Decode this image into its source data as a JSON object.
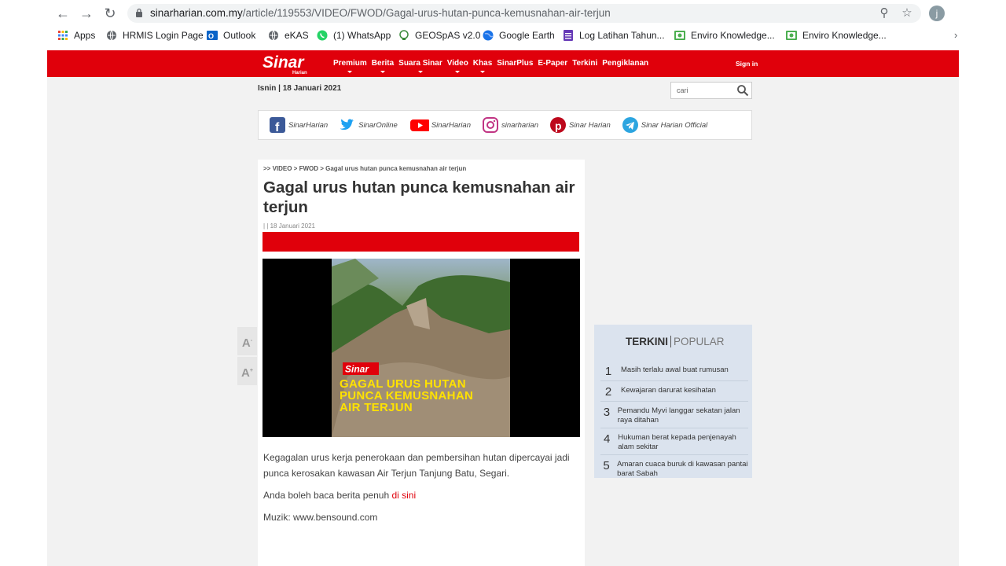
{
  "browser": {
    "url_host": "sinarharian.com.my",
    "url_path": "/article/119553/VIDEO/FWOD/Gagal-urus-hutan-punca-kemusnahan-air-terjun",
    "profile_initial": "j",
    "bookmarks": [
      {
        "label": "Apps",
        "icon": "apps-grid-icon"
      },
      {
        "label": "HRMIS Login Page",
        "icon": "globe-icon"
      },
      {
        "label": "Outlook",
        "icon": "outlook-icon"
      },
      {
        "label": "eKAS",
        "icon": "globe-icon"
      },
      {
        "label": "(1) WhatsApp",
        "icon": "whatsapp-icon"
      },
      {
        "label": "GEOSpAS v2.0",
        "icon": "geospas-icon"
      },
      {
        "label": "Google Earth",
        "icon": "google-earth-icon"
      },
      {
        "label": "Log Latihan Tahun...",
        "icon": "forms-icon"
      },
      {
        "label": "Enviro Knowledge...",
        "icon": "enviro-icon"
      },
      {
        "label": "Enviro Knowledge...",
        "icon": "enviro-icon"
      }
    ]
  },
  "site": {
    "brand_color": "#e0000b",
    "logo_text": "Sinar",
    "logo_subtext": "Harian",
    "menu": [
      "Premium",
      "Berita",
      "Suara Sinar",
      "Video",
      "Khas",
      "SinarPlus",
      "E-Paper",
      "Terkini",
      "Pengiklanan"
    ],
    "signin": "Sign in",
    "date": "Isnin | 18 Januari 2021",
    "search_placeholder": "cari",
    "social": [
      {
        "label": "SinarHarian",
        "icon": "facebook-icon"
      },
      {
        "label": "SinarOnline",
        "icon": "twitter-icon"
      },
      {
        "label": "SinarHarian",
        "icon": "youtube-icon"
      },
      {
        "label": "sinarharian",
        "icon": "instagram-icon"
      },
      {
        "label": "Sinar Harian",
        "icon": "pinterest-icon"
      },
      {
        "label": "Sinar Harian Official",
        "icon": "telegram-icon"
      }
    ]
  },
  "article": {
    "breadcrumb": ">> VIDEO > FWOD > Gagal urus hutan punca kemusnahan air terjun",
    "title": "Gagal urus hutan punca kemusnahan air terjun",
    "meta": "| | 18 Januari 2021",
    "video_logo": "Sinar",
    "video_caption": "GAGAL URUS HUTAN PUNCA KEMUSNAHAN AIR TERJUN",
    "paragraph1": "Kegagalan urus kerja penerokaan dan pembersihan hutan dipercayai jadi punca kerosakan kawasan Air Terjun Tanjung Batu, Segari.",
    "paragraph2_prefix": "Anda boleh baca berita penuh ",
    "paragraph2_link": "di sini",
    "paragraph3": "Muzik: www.bensound.com"
  },
  "font_controls": {
    "smaller": "A",
    "larger": "A",
    "minus": "-",
    "plus": "+"
  },
  "sidebar": {
    "tab_active": "TERKINI",
    "tab_other": "POPULAR",
    "items": [
      {
        "num": "1",
        "text": "Masih terlalu awal buat rumusan"
      },
      {
        "num": "2",
        "text": "Kewajaran darurat kesihatan"
      },
      {
        "num": "3",
        "text": "Pemandu Myvi langgar sekatan jalan raya ditahan"
      },
      {
        "num": "4",
        "text": "Hukuman berat kepada penjenayah alam sekitar"
      },
      {
        "num": "5",
        "text": "Amaran cuaca buruk di kawasan pantai barat Sabah"
      }
    ]
  }
}
